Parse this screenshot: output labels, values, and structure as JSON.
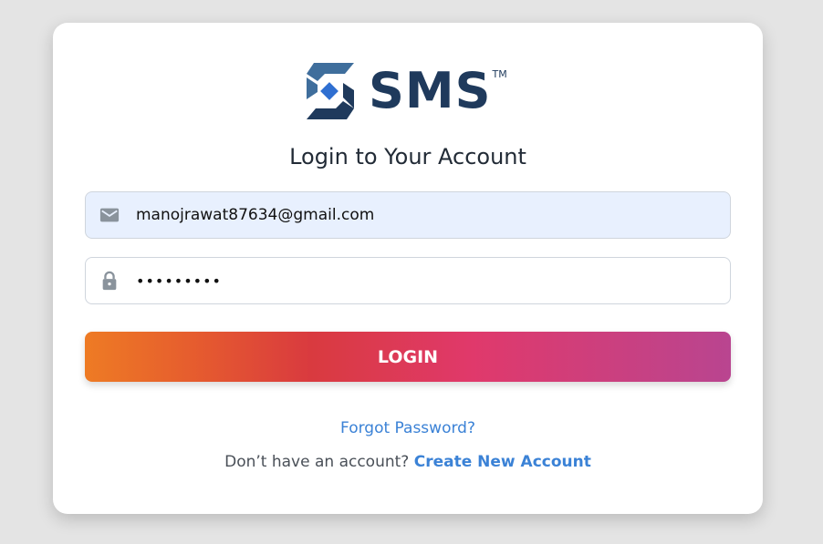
{
  "logo": {
    "text": "SMS",
    "trademark": "TM",
    "brand_color": "#1f3a5c",
    "accent_color": "#2f6fd1"
  },
  "heading": "Login to Your Account",
  "email_field": {
    "icon": "mail-icon",
    "value": "manojrawat87634@gmail.com"
  },
  "password_field": {
    "icon": "lock-icon",
    "value": "•••••••••"
  },
  "login_button": {
    "label": "LOGIN"
  },
  "forgot_link": "Forgot Password?",
  "signup": {
    "prompt": "Don’t have an account?",
    "link": "Create New Account"
  },
  "colors": {
    "link": "#3b82d6",
    "background": "#e4e4e4"
  }
}
